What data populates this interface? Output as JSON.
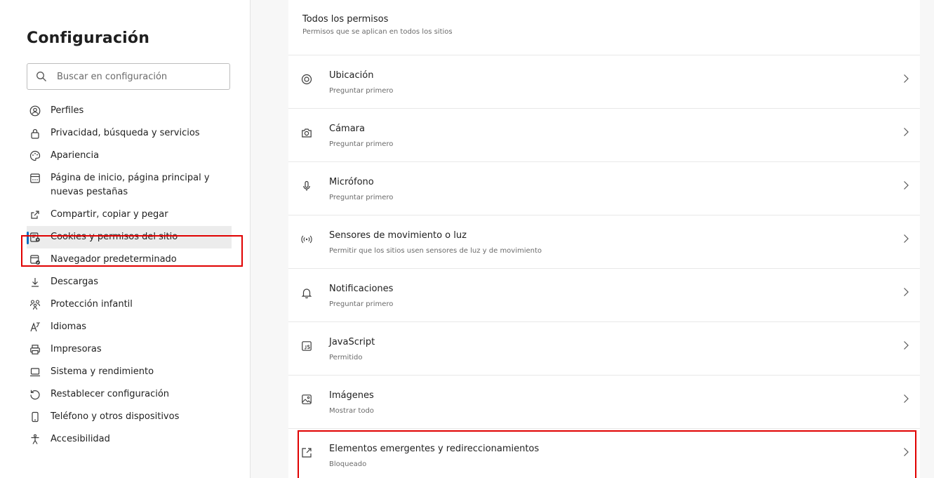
{
  "sidebar": {
    "title": "Configuración",
    "search": {
      "placeholder": "Buscar en configuración",
      "value": ""
    },
    "items": [
      {
        "label": "Perfiles",
        "icon": "profile-icon"
      },
      {
        "label": "Privacidad, búsqueda y servicios",
        "icon": "lock-icon"
      },
      {
        "label": "Apariencia",
        "icon": "palette-icon"
      },
      {
        "label": "Página de inicio, página principal y nuevas pestañas",
        "icon": "home-tabs-icon"
      },
      {
        "label": "Compartir, copiar y pegar",
        "icon": "share-icon"
      },
      {
        "label": "Cookies y permisos del sitio",
        "icon": "cookie-settings-icon",
        "active": true
      },
      {
        "label": "Navegador predeterminado",
        "icon": "default-browser-icon"
      },
      {
        "label": "Descargas",
        "icon": "download-icon"
      },
      {
        "label": "Protección infantil",
        "icon": "family-icon"
      },
      {
        "label": "Idiomas",
        "icon": "language-icon"
      },
      {
        "label": "Impresoras",
        "icon": "printer-icon"
      },
      {
        "label": "Sistema y rendimiento",
        "icon": "laptop-icon"
      },
      {
        "label": "Restablecer configuración",
        "icon": "reset-icon"
      },
      {
        "label": "Teléfono y otros dispositivos",
        "icon": "phone-icon"
      },
      {
        "label": "Accesibilidad",
        "icon": "accessibility-icon"
      }
    ]
  },
  "main": {
    "section": {
      "title": "Todos los permisos",
      "subtitle": "Permisos que se aplican en todos los sitios"
    },
    "permissions": [
      {
        "title": "Ubicación",
        "subtitle": "Preguntar primero",
        "icon": "location-icon"
      },
      {
        "title": "Cámara",
        "subtitle": "Preguntar primero",
        "icon": "camera-icon"
      },
      {
        "title": "Micrófono",
        "subtitle": "Preguntar primero",
        "icon": "microphone-icon"
      },
      {
        "title": "Sensores de movimiento o luz",
        "subtitle": "Permitir que los sitios usen sensores de luz y de movimiento",
        "icon": "sensor-icon"
      },
      {
        "title": "Notificaciones",
        "subtitle": "Preguntar primero",
        "icon": "bell-icon"
      },
      {
        "title": "JavaScript",
        "subtitle": "Permitido",
        "icon": "javascript-icon"
      },
      {
        "title": "Imágenes",
        "subtitle": "Mostrar todo",
        "icon": "image-icon"
      },
      {
        "title": "Elementos emergentes y redireccionamientos",
        "subtitle": "Bloqueado",
        "icon": "popup-icon"
      }
    ]
  },
  "colors": {
    "accent": "#0f6cbd",
    "highlight": "#e00000",
    "active_bg": "#ececec",
    "main_bg": "#f7f7f7"
  }
}
